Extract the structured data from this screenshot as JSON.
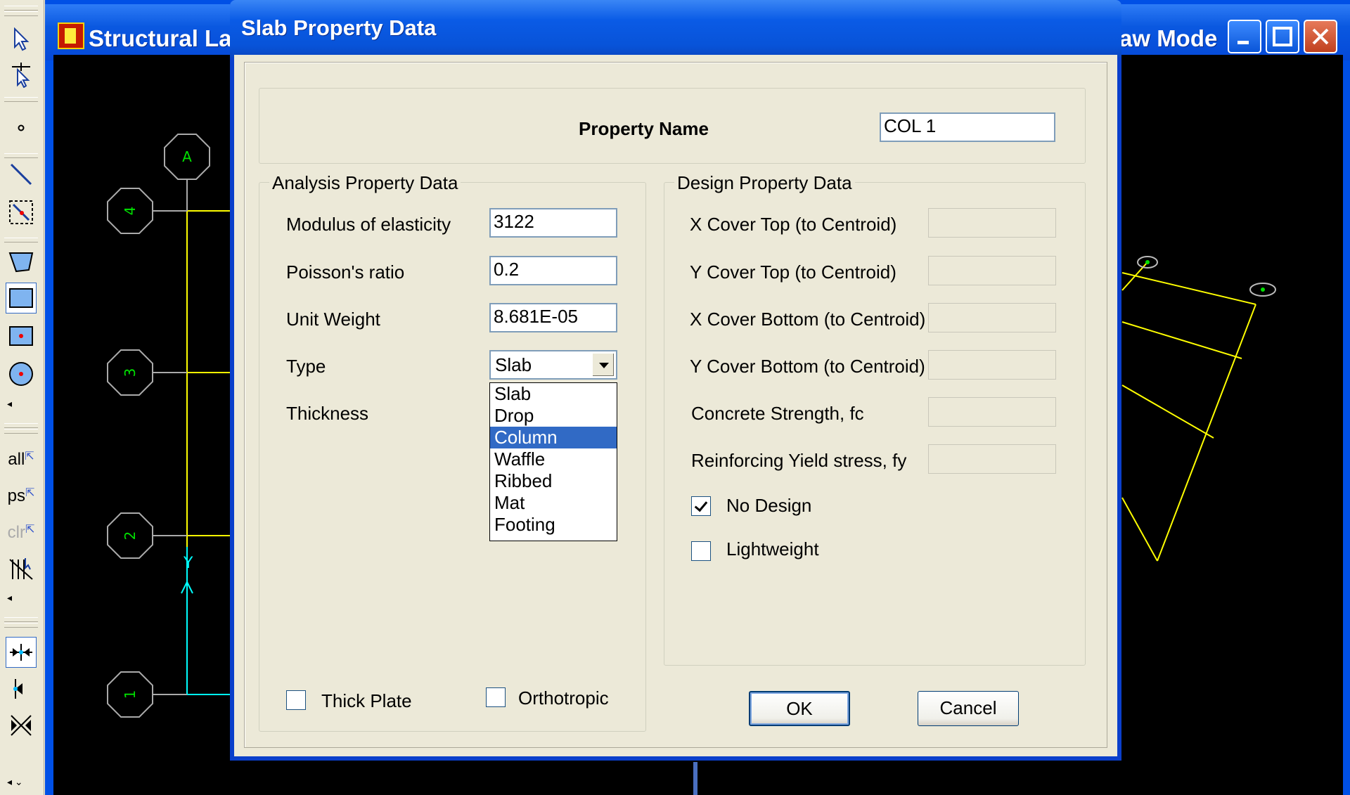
{
  "background_window": {
    "title_left": "Structural La",
    "title_right": "aw Mode",
    "grid_labels": [
      "A",
      "4",
      "3",
      "2",
      "1",
      "Y"
    ]
  },
  "toolbar": {
    "text_buttons": [
      "all",
      "ps",
      "clr"
    ]
  },
  "dialog": {
    "title": "Slab Property Data",
    "property_name_label": "Property Name",
    "property_name_value": "COL 1",
    "analysis": {
      "group_title": "Analysis Property Data",
      "modulus_label": "Modulus of elasticity",
      "modulus_value": "3122",
      "poisson_label": "Poisson's ratio",
      "poisson_value": "0.2",
      "unit_weight_label": "Unit Weight",
      "unit_weight_value": "8.681E-05",
      "type_label": "Type",
      "type_value": "Slab",
      "type_options": [
        "Slab",
        "Drop",
        "Column",
        "Waffle",
        "Ribbed",
        "Mat",
        "Footing"
      ],
      "type_highlighted": "Column",
      "thickness_label": "Thickness",
      "thick_plate_label": "Thick Plate",
      "thick_plate_checked": false,
      "orthotropic_label": "Orthotropic",
      "orthotropic_checked": false
    },
    "design": {
      "group_title": "Design Property Data",
      "x_cover_top_label": "X Cover Top (to Centroid)",
      "y_cover_top_label": "Y Cover Top (to Centroid)",
      "x_cover_bottom_label": "X Cover Bottom (to Centroid)",
      "y_cover_bottom_label": "Y Cover Bottom (to Centroid)",
      "concrete_strength_label": "Concrete Strength, fc",
      "yield_stress_label": "Reinforcing Yield stress, fy",
      "no_design_label": "No Design",
      "no_design_checked": true,
      "lightweight_label": "Lightweight",
      "lightweight_checked": false
    },
    "ok_label": "OK",
    "cancel_label": "Cancel"
  }
}
